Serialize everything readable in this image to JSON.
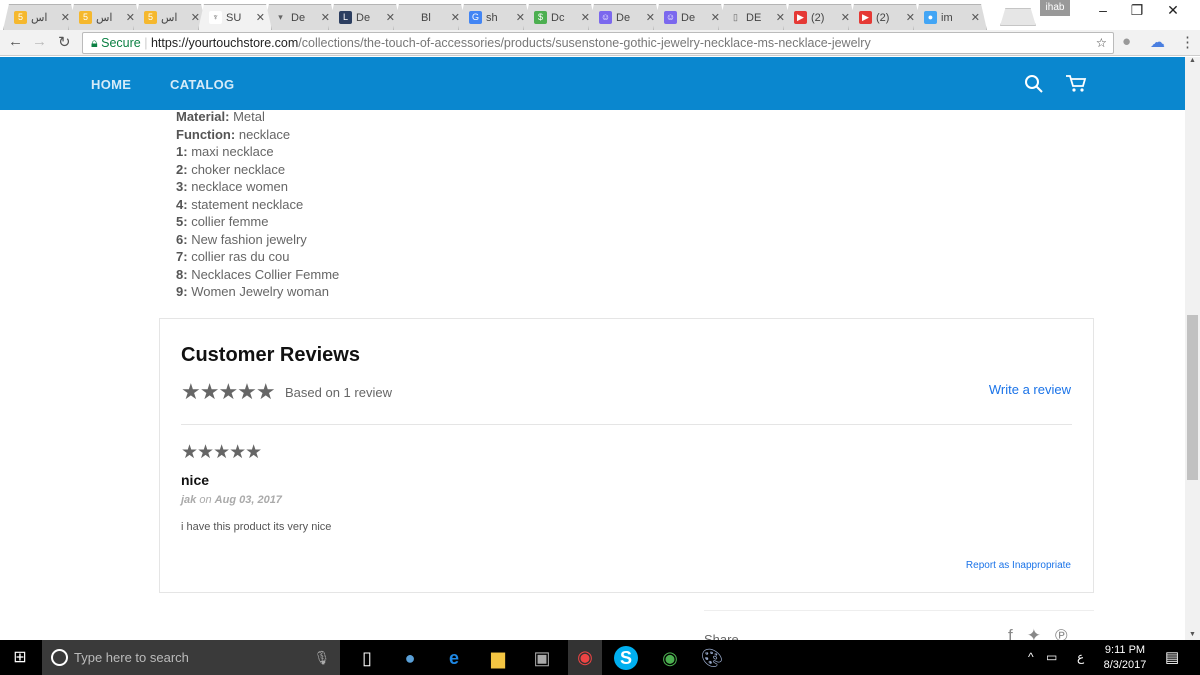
{
  "browser": {
    "tabs": [
      {
        "title": "اس",
        "favicon": "5",
        "color": "#f5b82e"
      },
      {
        "title": "اس",
        "favicon": "5",
        "color": "#f5b82e"
      },
      {
        "title": "اس",
        "favicon": "5",
        "color": "#f5b82e"
      },
      {
        "title": "SU",
        "favicon": "♆",
        "color": "#ffffff",
        "active": true
      },
      {
        "title": "De",
        "favicon": "▾",
        "color": "#dcdcdc"
      },
      {
        "title": "De",
        "favicon": "L",
        "color": "#2c3e60"
      },
      {
        "title": "Bl",
        "favicon": "",
        "color": "#dcdcdc"
      },
      {
        "title": "sh",
        "favicon": "G",
        "color": "#4285f4"
      },
      {
        "title": "Dc",
        "favicon": "$",
        "color": "#4caf50"
      },
      {
        "title": "De",
        "favicon": "☺",
        "color": "#7b68ee"
      },
      {
        "title": "De",
        "favicon": "☺",
        "color": "#7b68ee"
      },
      {
        "title": "DE",
        "favicon": "▯",
        "color": "#dcdcdc"
      },
      {
        "title": "(2)",
        "favicon": "▶",
        "color": "#e53935"
      },
      {
        "title": "(2)",
        "favicon": "▶",
        "color": "#e53935"
      },
      {
        "title": "im",
        "favicon": "●",
        "color": "#42a5f5"
      }
    ],
    "user": "ihab",
    "secure_label": "Secure",
    "url_host": "https://yourtouchstore.com",
    "url_path": "/collections/the-touch-of-accessories/products/susenstone-gothic-jewelry-necklace-ms-necklace-jewelry"
  },
  "site": {
    "nav": [
      "HOME",
      "CATALOG"
    ],
    "accent": "#0a87cf"
  },
  "specs": [
    {
      "k": "Material:",
      "v": "Metal"
    },
    {
      "k": "Function:",
      "v": "necklace"
    },
    {
      "k": "1:",
      "v": "maxi necklace"
    },
    {
      "k": "2:",
      "v": "choker necklace"
    },
    {
      "k": "3:",
      "v": "necklace women"
    },
    {
      "k": "4:",
      "v": "statement necklace"
    },
    {
      "k": "5:",
      "v": "collier femme"
    },
    {
      "k": "6:",
      "v": "New fashion jewelry"
    },
    {
      "k": "7:",
      "v": "collier ras du cou"
    },
    {
      "k": "8:",
      "v": "Necklaces Collier Femme"
    },
    {
      "k": "9:",
      "v": "Women Jewelry woman"
    }
  ],
  "reviews": {
    "title": "Customer Reviews",
    "stars": "★★★★★",
    "rating": 5,
    "summary": "Based on 1 review",
    "write": "Write a review",
    "items": [
      {
        "stars": "★★★★★",
        "rating": 5,
        "title": "nice",
        "author": "jak",
        "on": "on",
        "date": "Aug 03, 2017",
        "body": "i have this product its very nice",
        "report": "Report as Inappropriate"
      }
    ]
  },
  "share": "Share",
  "taskbar": {
    "search_placeholder": "Type here to search",
    "time": "9:11 PM",
    "date": "8/3/2017",
    "lang": "ع"
  }
}
